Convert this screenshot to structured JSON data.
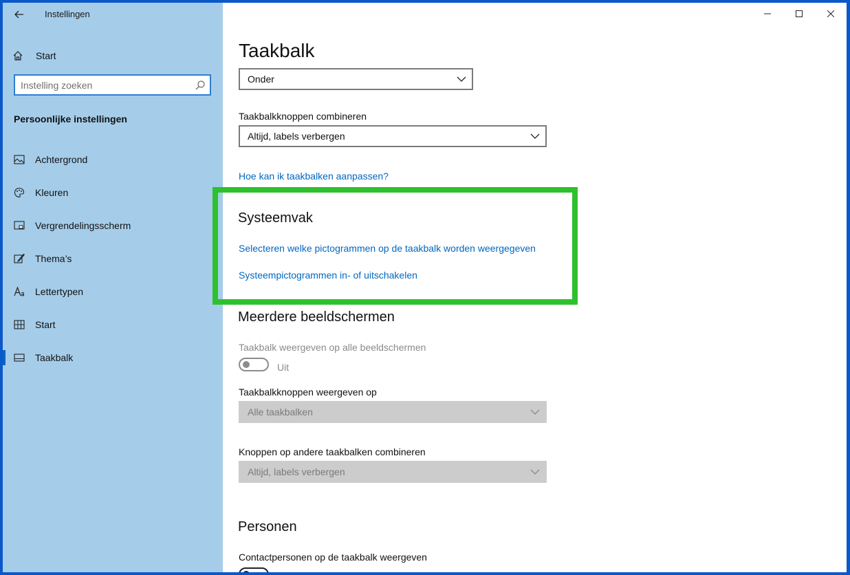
{
  "app": {
    "title": "Instellingen"
  },
  "sidebar": {
    "home_label": "Start",
    "search_placeholder": "Instelling zoeken",
    "section_title": "Persoonlijke instellingen",
    "items": [
      {
        "label": "Achtergrond",
        "icon": "picture-icon"
      },
      {
        "label": "Kleuren",
        "icon": "palette-icon"
      },
      {
        "label": "Vergrendelingsscherm",
        "icon": "lock-screen-icon"
      },
      {
        "label": "Thema’s",
        "icon": "theme-brush-icon"
      },
      {
        "label": "Lettertypen",
        "icon": "font-icon"
      },
      {
        "label": "Start",
        "icon": "start-tiles-icon"
      },
      {
        "label": "Taakbalk",
        "icon": "taskbar-icon",
        "active": true
      }
    ]
  },
  "main": {
    "title": "Taakbalk",
    "position_dropdown": {
      "value": "Onder"
    },
    "combine_label": "Taakbalkknoppen combineren",
    "combine_dropdown": {
      "value": "Altijd, labels verbergen"
    },
    "help_link": "Hoe kan ik taakbalken aanpassen?",
    "system_tray": {
      "heading": "Systeemvak",
      "link1": "Selecteren welke pictogrammen op de taakbalk worden weergegeven",
      "link2": "Systeempictogrammen in- of uitschakelen"
    },
    "multi_display": {
      "heading": "Meerdere beeldschermen",
      "show_all_label": "Taakbalk weergeven op alle beeldschermen",
      "toggle_state": "Uit",
      "show_buttons_label": "Taakbalkknoppen weergeven op",
      "show_buttons_dropdown": "Alle taakbalken",
      "combine_other_label": "Knoppen op andere taakbalken combineren",
      "combine_other_dropdown": "Altijd, labels verbergen"
    },
    "people": {
      "heading": "Personen",
      "contacts_label": "Contactpersonen op de taakbalk weergeven"
    }
  },
  "colors": {
    "sidebar_bg": "#a5cdea",
    "accent": "#0067c0",
    "highlight": "#2ec12e",
    "frame": "#0a58ca"
  }
}
